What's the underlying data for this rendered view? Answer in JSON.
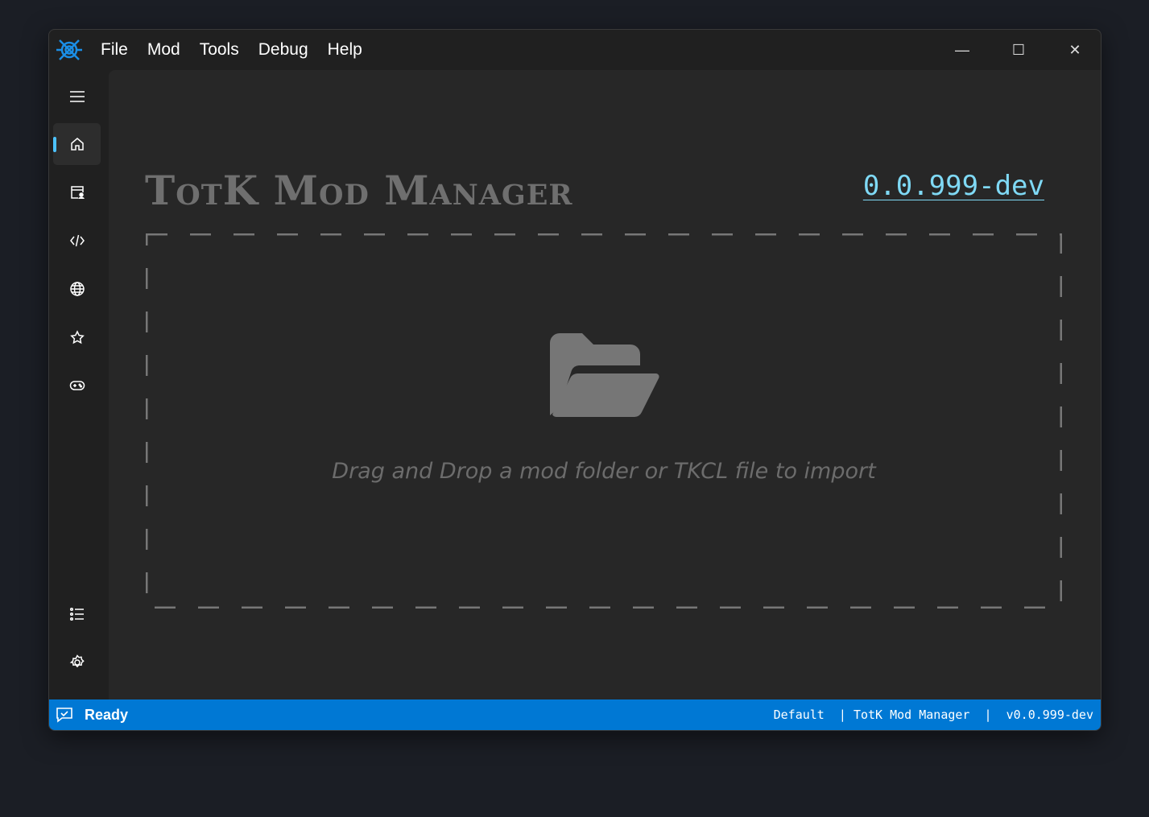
{
  "menu": [
    "File",
    "Mod",
    "Tools",
    "Debug",
    "Help"
  ],
  "window_controls": {
    "minimize": "—",
    "maximize": "☐",
    "close": "✕"
  },
  "sidebar": {
    "items": [
      {
        "name": "menu-icon"
      },
      {
        "name": "home-icon",
        "active": true
      },
      {
        "name": "mod-profile-icon"
      },
      {
        "name": "code-icon"
      },
      {
        "name": "globe-icon"
      },
      {
        "name": "star-icon"
      },
      {
        "name": "gamepad-icon"
      },
      {
        "name": "list-icon"
      },
      {
        "name": "settings-icon"
      }
    ]
  },
  "main": {
    "title": "TotK Mod Manager",
    "version": "0.0.999-dev",
    "drop_text": "Drag and Drop a mod folder or TKCL file to import"
  },
  "status": {
    "text": "Ready",
    "profile": "Default",
    "app": "TotK Mod Manager",
    "version": "v0.0.999-dev",
    "sep": "|"
  },
  "colors": {
    "accent": "#0078d4",
    "link": "#7fd9f5"
  }
}
